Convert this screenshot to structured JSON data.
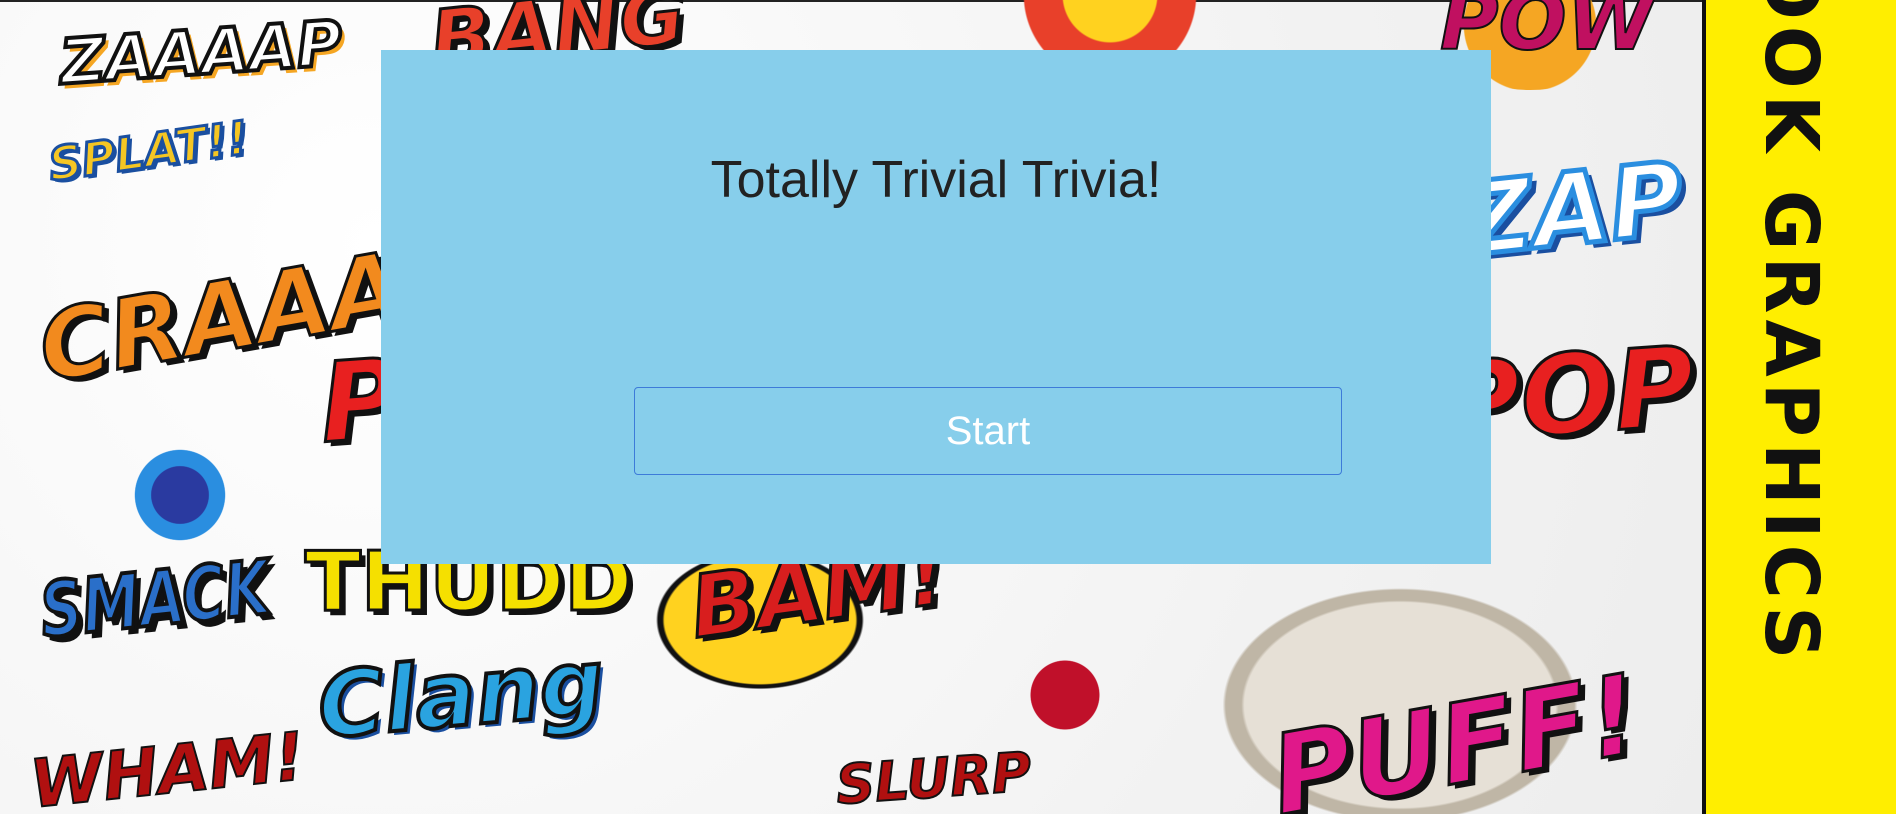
{
  "app": {
    "title": "Totally Trivial Trivia!",
    "start_label": "Start"
  },
  "background": {
    "words": [
      {
        "text": "ZAAAAP",
        "color": "#111111"
      },
      {
        "text": "BANG",
        "color": "#e8402a"
      },
      {
        "text": "POW",
        "color": "#c01060"
      },
      {
        "text": "SPLAT!!",
        "color": "#f5a623"
      },
      {
        "text": "CRAAAAAK",
        "color": "#f28a1e"
      },
      {
        "text": "ZAP",
        "color": "#2a8ee0"
      },
      {
        "text": "POP",
        "color": "#e82020"
      },
      {
        "text": "SMACK",
        "color": "#2a6fc9"
      },
      {
        "text": "THUDD",
        "color": "#f5e000"
      },
      {
        "text": "BAM!",
        "color": "#d81e1e"
      },
      {
        "text": "Clang",
        "color": "#2aa3e0"
      },
      {
        "text": "WHAM!",
        "color": "#b01010"
      },
      {
        "text": "SLURP",
        "color": "#b01010"
      },
      {
        "text": "PUFF!",
        "color": "#e0188a"
      }
    ],
    "banner_text": "COMIC BOOK GRAPHICS"
  },
  "colors": {
    "panel": "#87ceeb",
    "button_border": "#3d7bd9",
    "banner": "#ffee00"
  }
}
